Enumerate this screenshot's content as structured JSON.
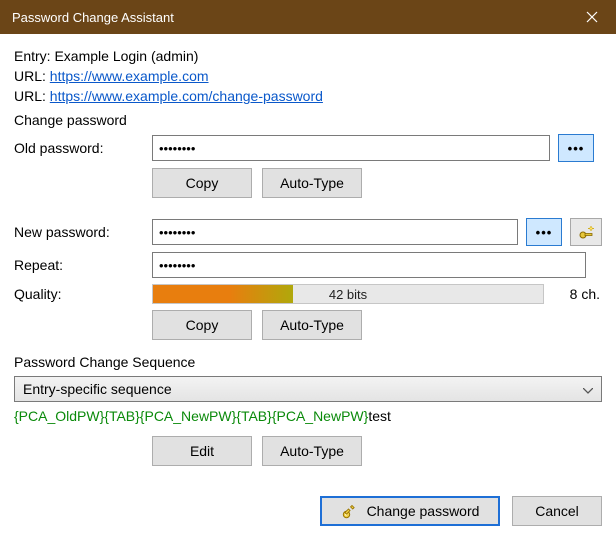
{
  "window": {
    "title": "Password Change Assistant"
  },
  "info": {
    "entry_prefix": "Entry: ",
    "entry_value": "Example Login (admin)",
    "url_prefix": "URL: ",
    "url1": "https://www.example.com",
    "url2": "https://www.example.com/change-password"
  },
  "section": {
    "change_password": "Change password",
    "sequence": "Password Change Sequence"
  },
  "labels": {
    "old_pw": "Old password:",
    "new_pw": "New password:",
    "repeat": "Repeat:",
    "quality": "Quality:"
  },
  "values": {
    "old_pw": "••••••••",
    "new_pw": "••••••••",
    "repeat": "••••••••"
  },
  "quality": {
    "text": "42 bits",
    "chars": "8 ch.",
    "fill_percent": 36
  },
  "buttons": {
    "copy": "Copy",
    "autotype": "Auto-Type",
    "edit": "Edit",
    "change": "Change password",
    "cancel": "Cancel"
  },
  "dropdown": {
    "selected": "Entry-specific sequence"
  },
  "sequence": {
    "prefix": "{PCA_OldPW}{TAB}{PCA_NewPW}{TAB}{PCA_NewPW}",
    "suffix": "test"
  }
}
